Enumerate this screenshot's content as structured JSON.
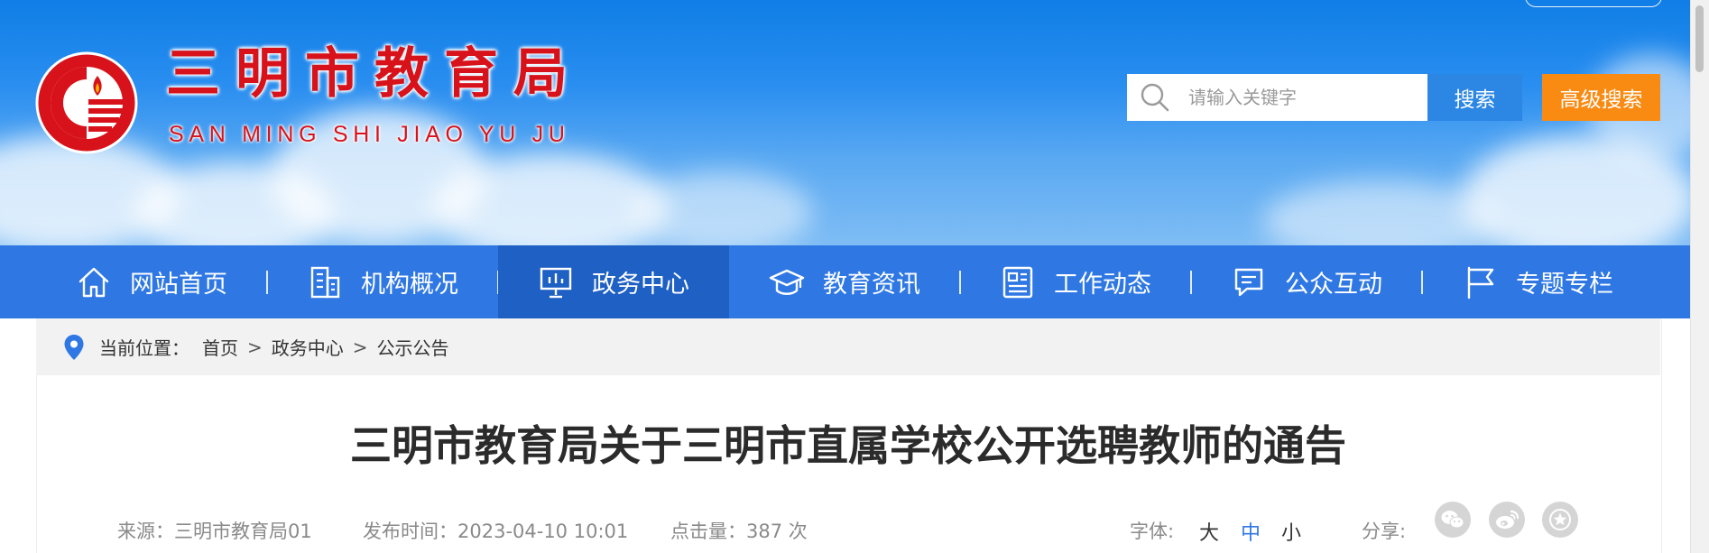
{
  "header": {
    "site_title": "三明市教育局",
    "site_subtitle": "SAN MING SHI JIAO YU JU",
    "search": {
      "placeholder": "请输入关键字",
      "button_label": "搜索"
    },
    "advanced_search_label": "高级搜索"
  },
  "nav": {
    "items": [
      {
        "label": "网站首页",
        "icon": "home-icon"
      },
      {
        "label": "机构概况",
        "icon": "building-icon"
      },
      {
        "label": "政务中心",
        "icon": "presentation-board-icon",
        "active": true
      },
      {
        "label": "教育资讯",
        "icon": "graduation-cap-icon"
      },
      {
        "label": "工作动态",
        "icon": "newspaper-icon"
      },
      {
        "label": "公众互动",
        "icon": "chat-bubble-icon"
      },
      {
        "label": "专题专栏",
        "icon": "flag-icon"
      }
    ]
  },
  "breadcrumb": {
    "label": "当前位置：",
    "items": [
      "首页",
      "政务中心",
      "公示公告"
    ],
    "separator": ">"
  },
  "article": {
    "title": "三明市教育局关于三明市直属学校公开选聘教师的通告",
    "source_label": "来源：",
    "source": "三明市教育局01",
    "publish_label": "发布时间：",
    "publish_time": "2023-04-10 10:01",
    "views_label": "点击量：",
    "views": "387 次",
    "font_size_label": "字体:",
    "font_sizes": [
      "大",
      "中",
      "小"
    ],
    "font_size_active": "中",
    "share_label": "分享:",
    "share_icons": [
      "wechat-icon",
      "weibo-icon",
      "favorite-star-icon"
    ]
  },
  "colors": {
    "brand_red": "#d8121a",
    "nav_blue": "#2f78e4",
    "nav_active": "#1e60c4",
    "search_blue": "#2b86e4",
    "accent_orange": "#f98a12"
  }
}
